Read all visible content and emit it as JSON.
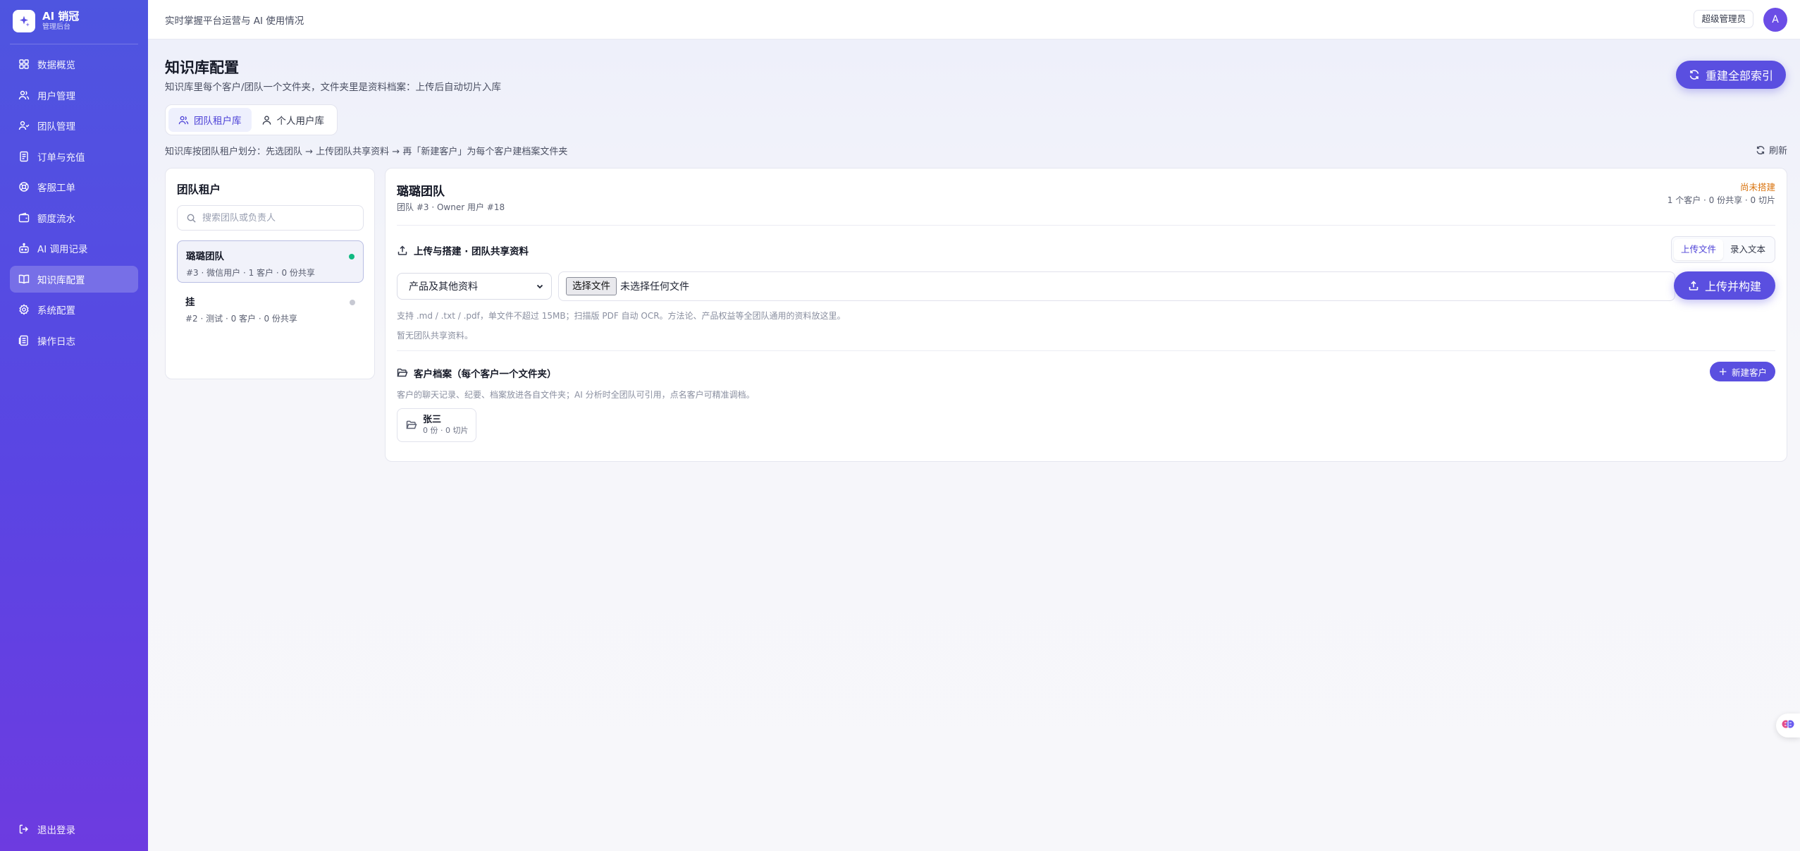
{
  "brand": {
    "name": "AI 销冠",
    "sub": "管理后台"
  },
  "sidebar": {
    "items": [
      {
        "label": "数据概览",
        "icon": "grid-icon"
      },
      {
        "label": "用户管理",
        "icon": "users-icon"
      },
      {
        "label": "团队管理",
        "icon": "team-icon"
      },
      {
        "label": "订单与充值",
        "icon": "receipt-icon"
      },
      {
        "label": "客服工单",
        "icon": "support-icon"
      },
      {
        "label": "额度流水",
        "icon": "wallet-icon"
      },
      {
        "label": "AI 调用记录",
        "icon": "bot-icon"
      },
      {
        "label": "知识库配置",
        "icon": "book-icon",
        "active": true
      },
      {
        "label": "系统配置",
        "icon": "gear-icon"
      },
      {
        "label": "操作日志",
        "icon": "log-icon"
      }
    ],
    "logout": "退出登录"
  },
  "topbar": {
    "subtitle": "实时掌握平台运营与 AI 使用情况",
    "role": "超级管理员",
    "avatar": "A"
  },
  "page": {
    "title": "知识库配置",
    "desc": "知识库里每个客户/团队一个文件夹，文件夹里是资料档案：上传后自动切片入库",
    "rebuild": "重建全部索引",
    "tabs": [
      "团队租户库",
      "个人用户库"
    ],
    "hint": "知识库按团队租户划分：先选团队 → 上传团队共享资料 → 再「新建客户」为每个客户建档案文件夹",
    "refresh": "刷新"
  },
  "tenants": {
    "title": "团队租户",
    "search_placeholder": "搜索团队或负责人",
    "items": [
      {
        "name": "璐璐团队",
        "meta": "#3 · 微信用户 · 1 客户 · 0 份共享",
        "status_color": "#10b981"
      },
      {
        "name": "挂",
        "meta": "#2 · 测试 · 0 客户 · 0 份共享",
        "status_color": "#c7c9d3"
      }
    ]
  },
  "detail": {
    "title": "璐璐团队",
    "sub": "团队 #3 · Owner 用户 #18",
    "status": "尚未搭建",
    "counts": "1 个客户 · 0 份共享 · 0 切片",
    "upload_section": "上传与搭建 · 团队共享资料",
    "modes": [
      "上传文件",
      "录入文本"
    ],
    "category": "产品及其他资料",
    "file_button": "选择文件",
    "file_status": "未选择任何文件",
    "upload_btn": "上传并构建",
    "support_note": "支持 .md / .txt / .pdf，单文件不超过 15MB；扫描版 PDF 自动 OCR。方法论、产品权益等全团队通用的资料放这里。",
    "empty_note": "暂无团队共享资料。",
    "client_section": "客户档案（每个客户一个文件夹）",
    "client_note": "客户的聊天记录、纪要、档案放进各自文件夹；AI 分析时全团队可引用，点名客户可精准调档。",
    "new_client": "新建客户",
    "clients": [
      {
        "name": "张三",
        "meta": "0 份 · 0 切片"
      }
    ]
  },
  "colors": {
    "accent": "#5a4fe0",
    "status_pending": "#d9730d",
    "online": "#10b981"
  }
}
